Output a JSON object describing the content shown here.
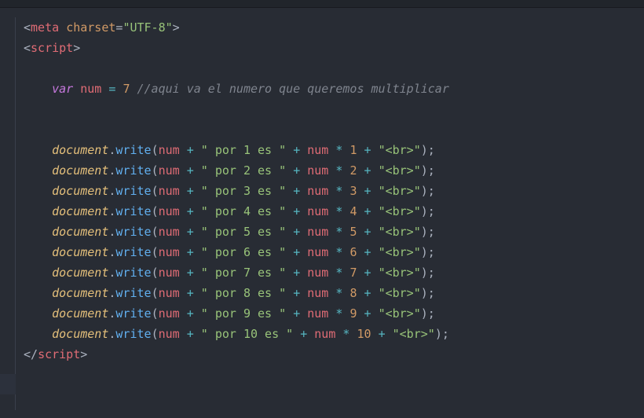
{
  "meta_line": {
    "lt": "<",
    "tag": "meta",
    "sp": " ",
    "attr": "charset",
    "eq": "=",
    "val": "\"UTF-8\"",
    "gt": ">"
  },
  "script_open": {
    "lt": "<",
    "tag": "script",
    "gt": ">"
  },
  "script_close": {
    "lt": "</",
    "tag": "script",
    "gt": ">"
  },
  "decl": {
    "indent": "    ",
    "kw": "var",
    "sp1": " ",
    "name": "num",
    "sp2": " ",
    "eq": "=",
    "sp3": " ",
    "val": "7",
    "sp4": " ",
    "comment": "//aqui va el numero que queremos multiplicar"
  },
  "call": {
    "indent": "    ",
    "obj": "document",
    "dot": ".",
    "fn": "write",
    "open": "(",
    "arg1": "num",
    "sp1": " ",
    "plus1": "+",
    "sp2": " ",
    "str1a": "\" por ",
    "str1b": " es \"",
    "sp3": " ",
    "plus2": "+",
    "sp4": " ",
    "arg2": "num",
    "sp5": " ",
    "star": "*",
    "sp6": " ",
    "sp7": " ",
    "plus3": "+",
    "sp8": " ",
    "str_br": "\"<br>\"",
    "close": ")",
    "semi": ";"
  },
  "multipliers": [
    "1",
    "2",
    "3",
    "4",
    "5",
    "6",
    "7",
    "8",
    "9",
    "10"
  ]
}
